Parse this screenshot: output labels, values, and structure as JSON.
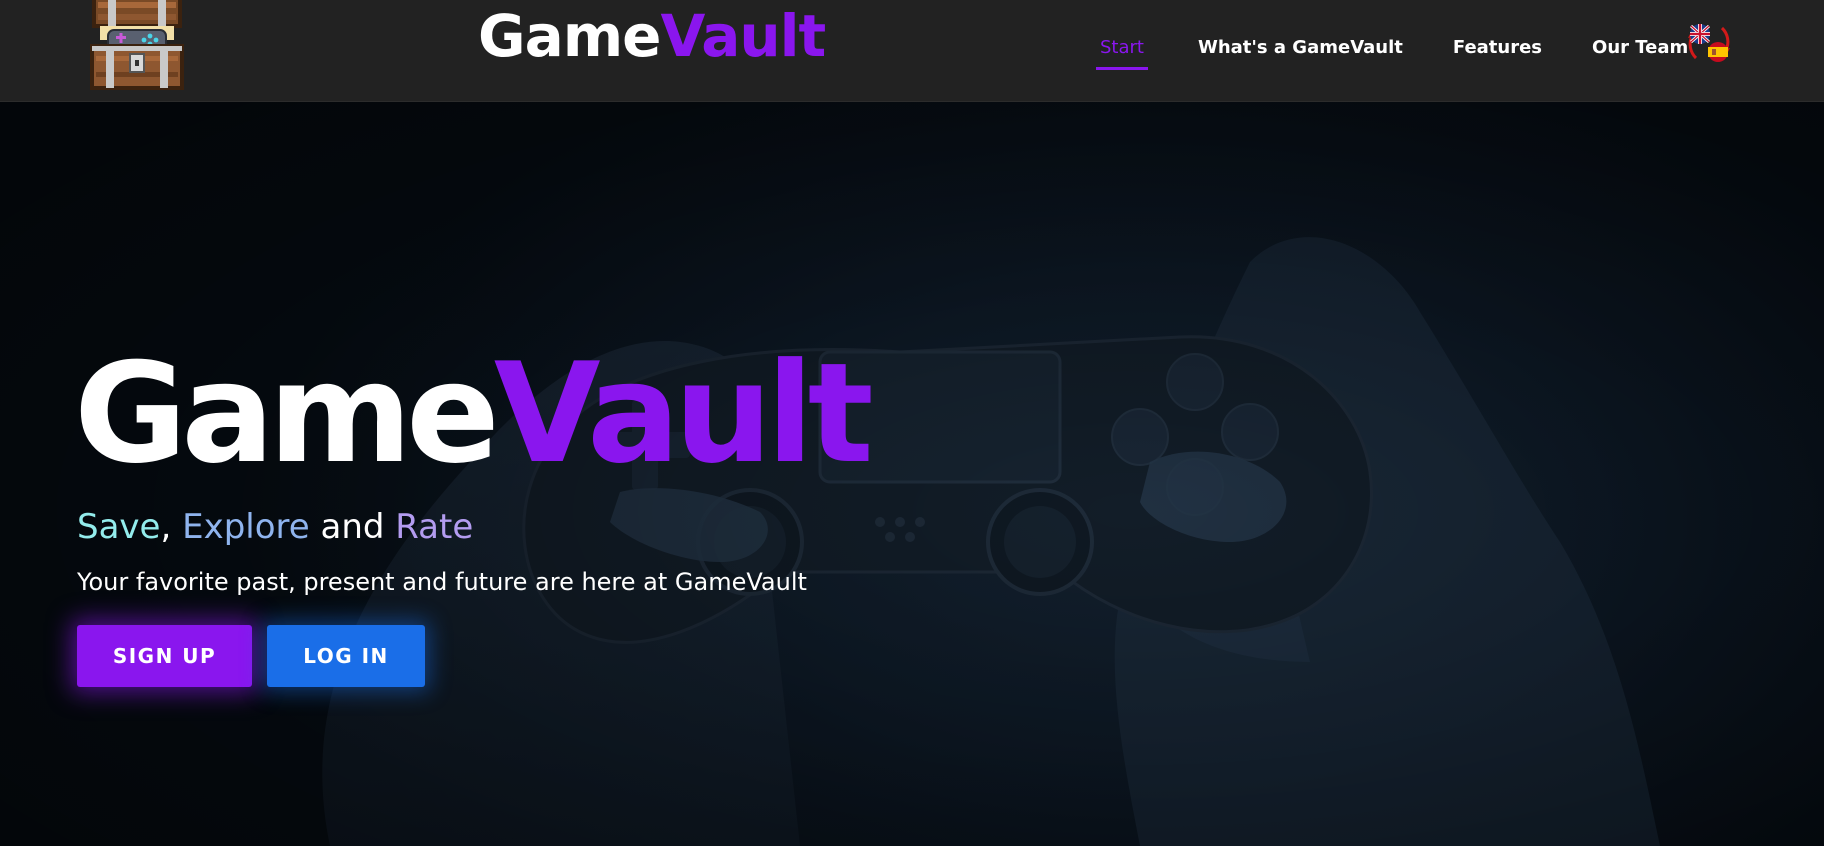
{
  "navbar": {
    "brand": {
      "part1": "Game",
      "part2": "Vault"
    },
    "links": [
      {
        "label": "Start",
        "active": true
      },
      {
        "label": "What's a GameVault",
        "active": false
      },
      {
        "label": "Features",
        "active": false
      },
      {
        "label": "Our Team",
        "active": false
      }
    ],
    "language_toggle": {
      "icon": "language-switch-icon",
      "languages": [
        "English",
        "Spanish"
      ]
    }
  },
  "hero": {
    "title": {
      "part1": "Game",
      "part2": "Vault"
    },
    "tagline": {
      "word1": "Save",
      "sep1": ", ",
      "word2": "Explore",
      "sep2": " and ",
      "word3": "Rate"
    },
    "subtitle": "Your favorite past, present and future are here at GameVault",
    "buttons": {
      "signup": "SIGN UP",
      "login": "LOG IN"
    }
  },
  "colors": {
    "accent_purple": "#8a16ee",
    "accent_blue": "#1a6ee8",
    "navbar_bg": "#222222",
    "tagline_save": "#93ecec",
    "tagline_explore": "#8fb4ee",
    "tagline_rate": "#b39cf0"
  }
}
